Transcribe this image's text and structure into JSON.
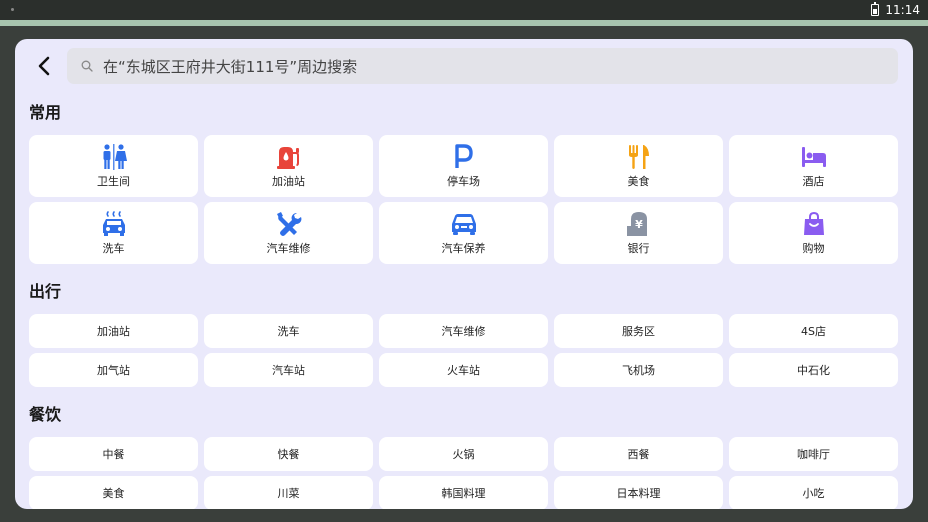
{
  "status": {
    "time": "11:14"
  },
  "search": {
    "placeholder": "在“东城区王府井大街111号”周边搜索"
  },
  "sections": {
    "common": {
      "title": "常用",
      "items": [
        {
          "label": "卫生间",
          "icon": "restroom-icon",
          "color": "#2f6fe8"
        },
        {
          "label": "加油站",
          "icon": "gas-station-icon",
          "color": "#e8443a"
        },
        {
          "label": "停车场",
          "icon": "parking-icon",
          "color": "#2f6fe8"
        },
        {
          "label": "美食",
          "icon": "fork-knife-icon",
          "color": "#f5a314"
        },
        {
          "label": "酒店",
          "icon": "bed-icon",
          "color": "#8a5cf0"
        },
        {
          "label": "洗车",
          "icon": "car-wash-icon",
          "color": "#2f6fe8"
        },
        {
          "label": "汽车维修",
          "icon": "wrench-screwdriver-icon",
          "color": "#2f6fe8"
        },
        {
          "label": "汽车保养",
          "icon": "car-maintenance-icon",
          "color": "#2f6fe8"
        },
        {
          "label": "银行",
          "icon": "bank-icon",
          "color": "#8a93a3"
        },
        {
          "label": "购物",
          "icon": "shopping-bag-icon",
          "color": "#8a5cf0"
        }
      ]
    },
    "travel": {
      "title": "出行",
      "items": [
        "加油站",
        "洗车",
        "汽车维修",
        "服务区",
        "4S店",
        "加气站",
        "汽车站",
        "火车站",
        "飞机场",
        "中石化"
      ]
    },
    "dining": {
      "title": "餐饮",
      "items": [
        "中餐",
        "快餐",
        "火锅",
        "西餐",
        "咖啡厅",
        "美食",
        "川菜",
        "韩国料理",
        "日本料理",
        "小吃"
      ]
    }
  }
}
